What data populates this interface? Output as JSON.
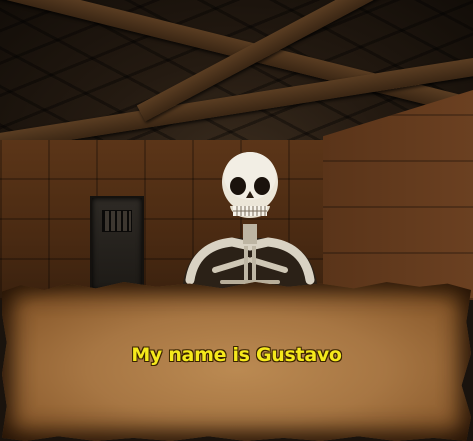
{
  "scene": {
    "type": "first-person dungeon room",
    "npc": "skeleton",
    "icons": [
      "skeleton-npc",
      "dungeon-door"
    ]
  },
  "dialog": {
    "text": "My name is Gustavo",
    "text_color": "#f5e91c",
    "panel_style": "parchment"
  }
}
